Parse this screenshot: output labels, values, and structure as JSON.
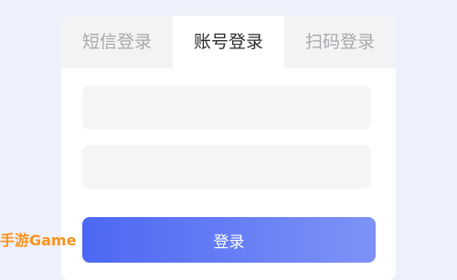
{
  "tabs": {
    "sms_login": "短信登录",
    "account_login": "账号登录",
    "qr_login": "扫码登录",
    "active": "account_login"
  },
  "form": {
    "username_value": "",
    "password_value": "",
    "login_label": "登录"
  },
  "watermark": {
    "text": "手游Game",
    "color": "#f7921e"
  },
  "colors": {
    "page_background": "#eef0fb",
    "button_gradient_start": "#4c68f3",
    "button_gradient_end": "#7e93f7",
    "inactive_tab_text": "#a9a9ad",
    "active_tab_text": "#2c2c2e"
  }
}
